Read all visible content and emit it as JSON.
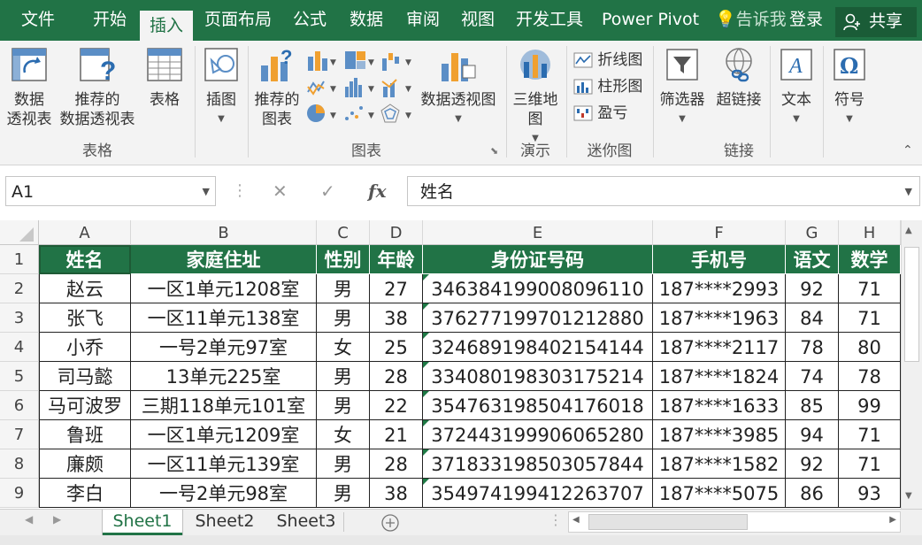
{
  "menu": {
    "tabs": [
      "文件",
      "开始",
      "插入",
      "页面布局",
      "公式",
      "数据",
      "审阅",
      "视图",
      "开发工具",
      "Power Pivot"
    ],
    "active_tab": "插入",
    "tell_me": "告诉我",
    "login": "登录",
    "share": "共享"
  },
  "ribbon": {
    "pivot_table": [
      "数据",
      "透视表"
    ],
    "recommended_pivot": [
      "推荐的",
      "数据透视表"
    ],
    "table": "表格",
    "group_tables": "表格",
    "illustrations": "插图",
    "recommended_charts": [
      "推荐的",
      "图表"
    ],
    "pivot_chart": "数据透视图",
    "group_charts": "图表",
    "map3d": [
      "三维地",
      "图"
    ],
    "group_tours": "演示",
    "spark_line": "折线图",
    "spark_column": "柱形图",
    "spark_winloss": "盈亏",
    "group_sparklines": "迷你图",
    "slicer": "筛选器",
    "hyperlink": "超链接",
    "group_links": "链接",
    "text": "文本",
    "symbol": "符号"
  },
  "formula_bar": {
    "name_box": "A1",
    "cancel": "✕",
    "enter": "✓",
    "fx": "fx",
    "content": "姓名"
  },
  "sheet": {
    "columns": [
      "A",
      "B",
      "C",
      "D",
      "E",
      "F",
      "G",
      "H"
    ],
    "row_numbers": [
      "1",
      "2",
      "3",
      "4",
      "5",
      "6",
      "7",
      "8",
      "9"
    ],
    "header": [
      "姓名",
      "家庭住址",
      "性别",
      "年龄",
      "身份证号码",
      "手机号",
      "语文",
      "数学"
    ],
    "rows": [
      [
        "赵云",
        "一区1单元1208室",
        "男",
        "27",
        "34638419900809 6110",
        "187****2993",
        "92",
        "71"
      ],
      [
        "张飞",
        "一区11单元138室",
        "男",
        "38",
        "376277199701212880",
        "187****1963",
        "84",
        "71"
      ],
      [
        "小乔",
        "一号2单元97室",
        "女",
        "25",
        "324689198402154144",
        "187****2117",
        "78",
        "80"
      ],
      [
        "司马懿",
        "13单元225室",
        "男",
        "28",
        "334080198303175214",
        "187****1824",
        "74",
        "78"
      ],
      [
        "马可波罗",
        "三期118单元101室",
        "男",
        "22",
        "354763198504176018",
        "187****1633",
        "85",
        "99"
      ],
      [
        "鲁班",
        "一区1单元1209室",
        "女",
        "21",
        "372443199906065280",
        "187****3985",
        "94",
        "71"
      ],
      [
        "廉颇",
        "一区11单元139室",
        "男",
        "28",
        "371833198503057844",
        "187****1582",
        "92",
        "71"
      ],
      [
        "李白",
        "一号2单元98室",
        "男",
        "38",
        "354974199412263707",
        "187****5075",
        "86",
        "93"
      ]
    ]
  },
  "sheet_tabs": [
    "Sheet1",
    "Sheet2",
    "Sheet3"
  ],
  "active_sheet": "Sheet1",
  "colors": {
    "excel_green": "#217346",
    "ribbon_bg": "#f3f3f3"
  }
}
